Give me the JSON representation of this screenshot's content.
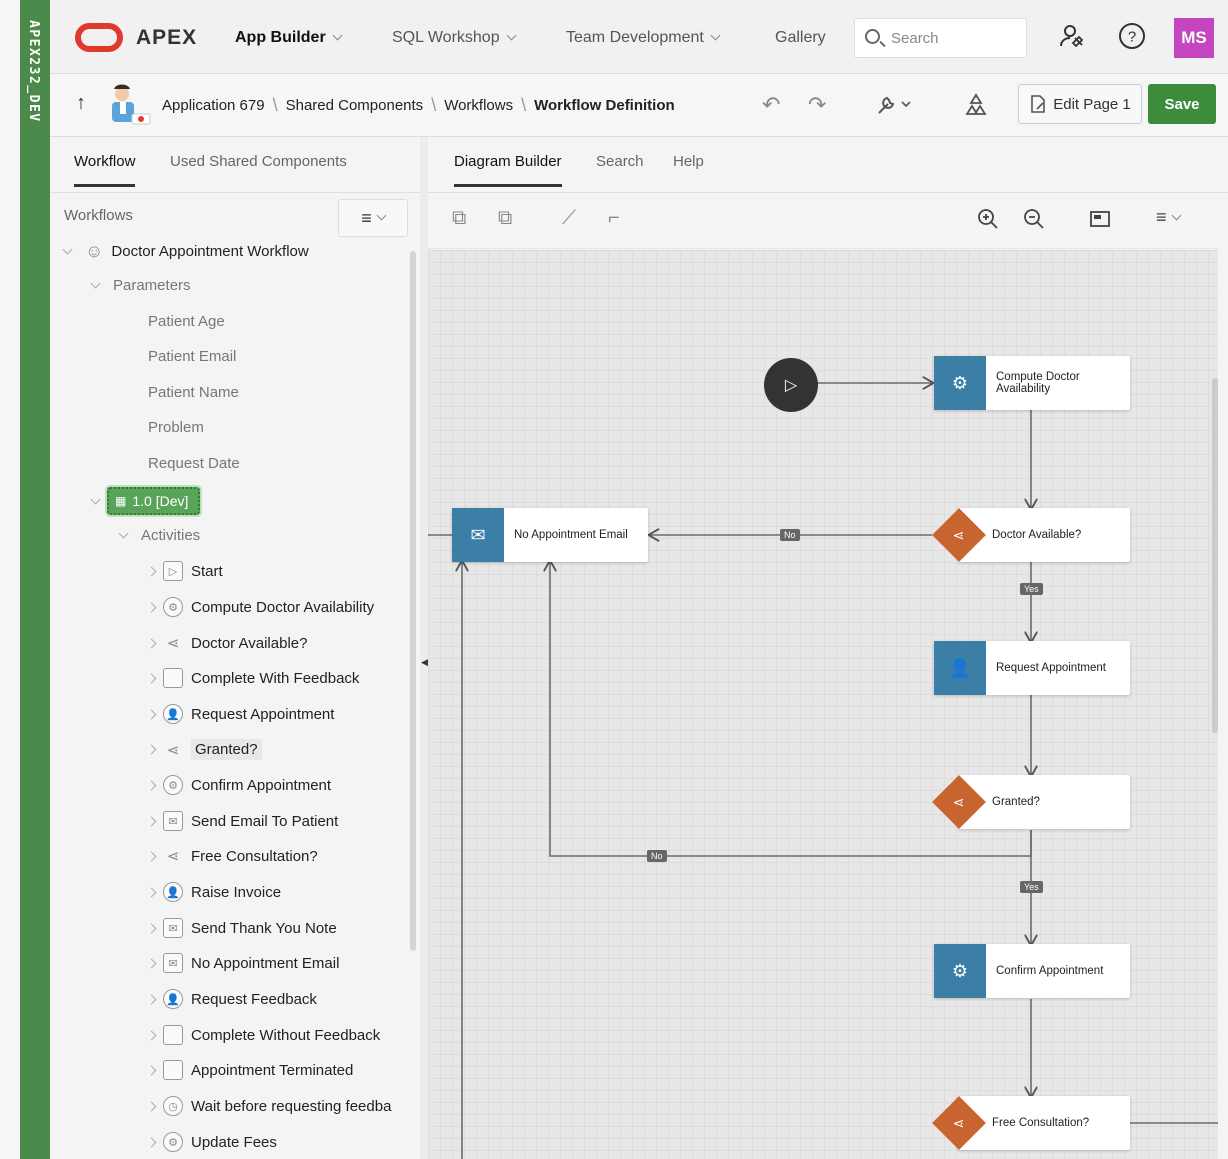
{
  "env": {
    "label": "APEX232_DEV"
  },
  "topbar": {
    "brand": "APEX",
    "nav": [
      {
        "label": "App Builder",
        "active": true,
        "has_menu": true
      },
      {
        "label": "SQL Workshop",
        "has_menu": true
      },
      {
        "label": "Team Development",
        "has_menu": true
      },
      {
        "label": "Gallery",
        "has_menu": false
      }
    ],
    "search_placeholder": "Search",
    "icons": [
      "user-settings-icon",
      "help-icon"
    ],
    "avatar": "MS",
    "colors": {
      "logo": "#e03a2f",
      "avatar": "#c545c0"
    }
  },
  "subbar": {
    "breadcrumbs": [
      "Application 679",
      "Shared Components",
      "Workflows",
      "Workflow Definition"
    ],
    "edit_page": "Edit Page 1",
    "save": "Save",
    "colors": {
      "save": "#3d8c3d"
    }
  },
  "left": {
    "tabs": [
      "Workflow",
      "Used Shared Components"
    ],
    "section_title": "Workflows",
    "workflow": "Doctor Appointment Workflow",
    "parameters_label": "Parameters",
    "parameters": [
      "Patient Age",
      "Patient Email",
      "Patient Name",
      "Problem",
      "Request Date"
    ],
    "version": "1.0 [Dev]",
    "activities_label": "Activities",
    "activities": [
      {
        "label": "Start",
        "icon": "play-icon"
      },
      {
        "label": "Compute Doctor Availability",
        "icon": "gear-icon"
      },
      {
        "label": "Doctor Available?",
        "icon": "switch-icon"
      },
      {
        "label": "Complete With Feedback",
        "icon": "square-icon"
      },
      {
        "label": "Request Appointment",
        "icon": "user-icon"
      },
      {
        "label": "Granted?",
        "icon": "switch-icon"
      },
      {
        "label": "Confirm Appointment",
        "icon": "gear-icon"
      },
      {
        "label": "Send Email To Patient",
        "icon": "mail-icon"
      },
      {
        "label": "Free Consultation?",
        "icon": "switch-icon"
      },
      {
        "label": "Raise Invoice",
        "icon": "user-icon"
      },
      {
        "label": "Send Thank You Note",
        "icon": "mail-icon"
      },
      {
        "label": "No Appointment Email",
        "icon": "mail-icon"
      },
      {
        "label": "Request Feedback",
        "icon": "user-icon"
      },
      {
        "label": "Complete Without Feedback",
        "icon": "square-icon"
      },
      {
        "label": "Appointment Terminated",
        "icon": "square-icon"
      },
      {
        "label": "Wait before requesting feedba",
        "icon": "clock-icon"
      },
      {
        "label": "Update Fees",
        "icon": "gear-icon"
      }
    ]
  },
  "right": {
    "tabs": [
      "Diagram Builder",
      "Search",
      "Help"
    ],
    "diagram": {
      "nodes": {
        "compute": "Compute Doctor Availability",
        "doctor_available": "Doctor Available?",
        "request": "Request Appointment",
        "granted": "Granted?",
        "confirm": "Confirm Appointment",
        "free": "Free Consultation?",
        "no_email": "No Appointment Email"
      },
      "labels": {
        "no": "No",
        "yes": "Yes"
      },
      "colors": {
        "activity": "#3b7ea6",
        "switch": "#c8642f"
      }
    }
  }
}
